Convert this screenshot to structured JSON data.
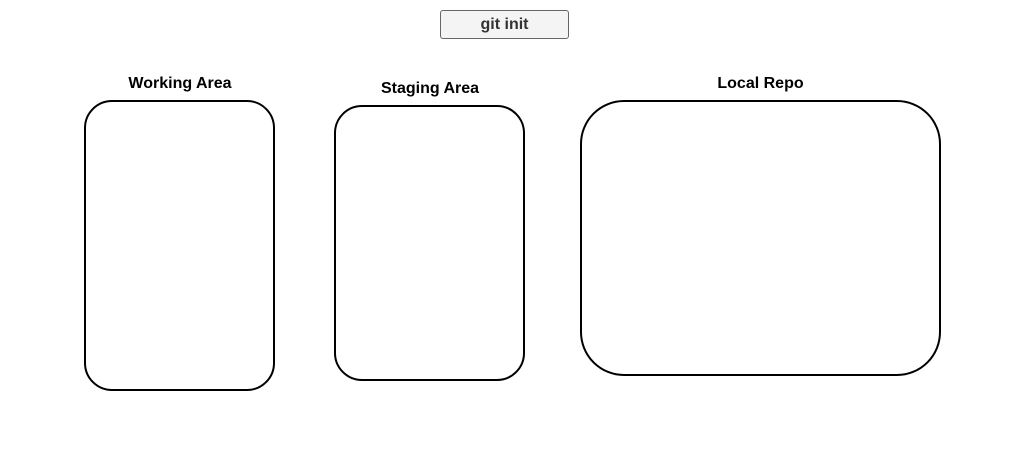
{
  "command_button": {
    "label": "git init"
  },
  "areas": [
    {
      "title": "Working Area"
    },
    {
      "title": "Staging Area"
    },
    {
      "title": "Local Repo"
    }
  ]
}
